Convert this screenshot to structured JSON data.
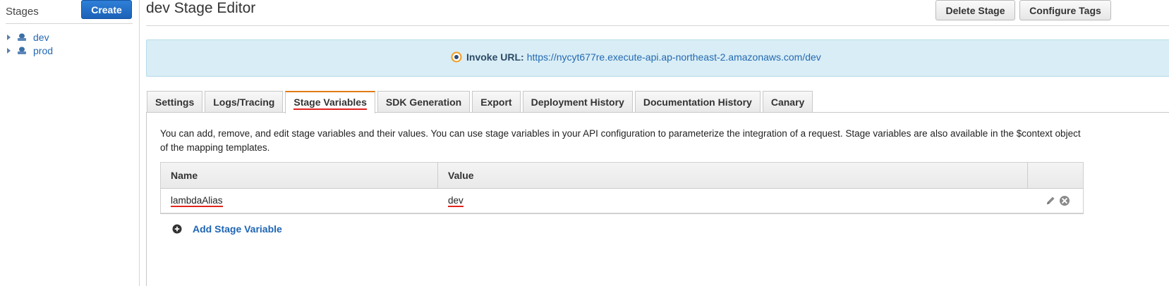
{
  "sidebar": {
    "header": "Stages",
    "create_label": "Create",
    "stages": [
      {
        "label": "dev"
      },
      {
        "label": "prod"
      }
    ]
  },
  "editor": {
    "title": "dev Stage Editor",
    "delete_label": "Delete Stage",
    "configure_tags_label": "Configure Tags"
  },
  "invoke": {
    "label": "Invoke URL:",
    "url": "https://nycyt677re.execute-api.ap-northeast-2.amazonaws.com/dev"
  },
  "tabs": [
    {
      "label": "Settings"
    },
    {
      "label": "Logs/Tracing"
    },
    {
      "label": "Stage Variables",
      "active": true
    },
    {
      "label": "SDK Generation"
    },
    {
      "label": "Export"
    },
    {
      "label": "Deployment History"
    },
    {
      "label": "Documentation History"
    },
    {
      "label": "Canary"
    }
  ],
  "stage_variables": {
    "description": "You can add, remove, and edit stage variables and their values. You can use stage variables in your API configuration to parameterize the integration of a request. Stage variables are also available in the $context object of the mapping templates.",
    "columns": {
      "name": "Name",
      "value": "Value"
    },
    "rows": [
      {
        "name": "lambdaAlias",
        "value": "dev"
      }
    ],
    "add_label": "Add Stage Variable"
  },
  "icons": {
    "stage": "stage-icon",
    "invoke": "invoke-status-icon",
    "edit": "pencil-icon",
    "delete": "remove-circle-icon",
    "add": "plus-circle-icon"
  },
  "colors": {
    "primary_button": "#1b62b8",
    "link": "#2469b3",
    "invoke_bg": "#d8edf5",
    "active_tab_accent": "#e07b18",
    "annotation_underline": "#e0231e"
  }
}
